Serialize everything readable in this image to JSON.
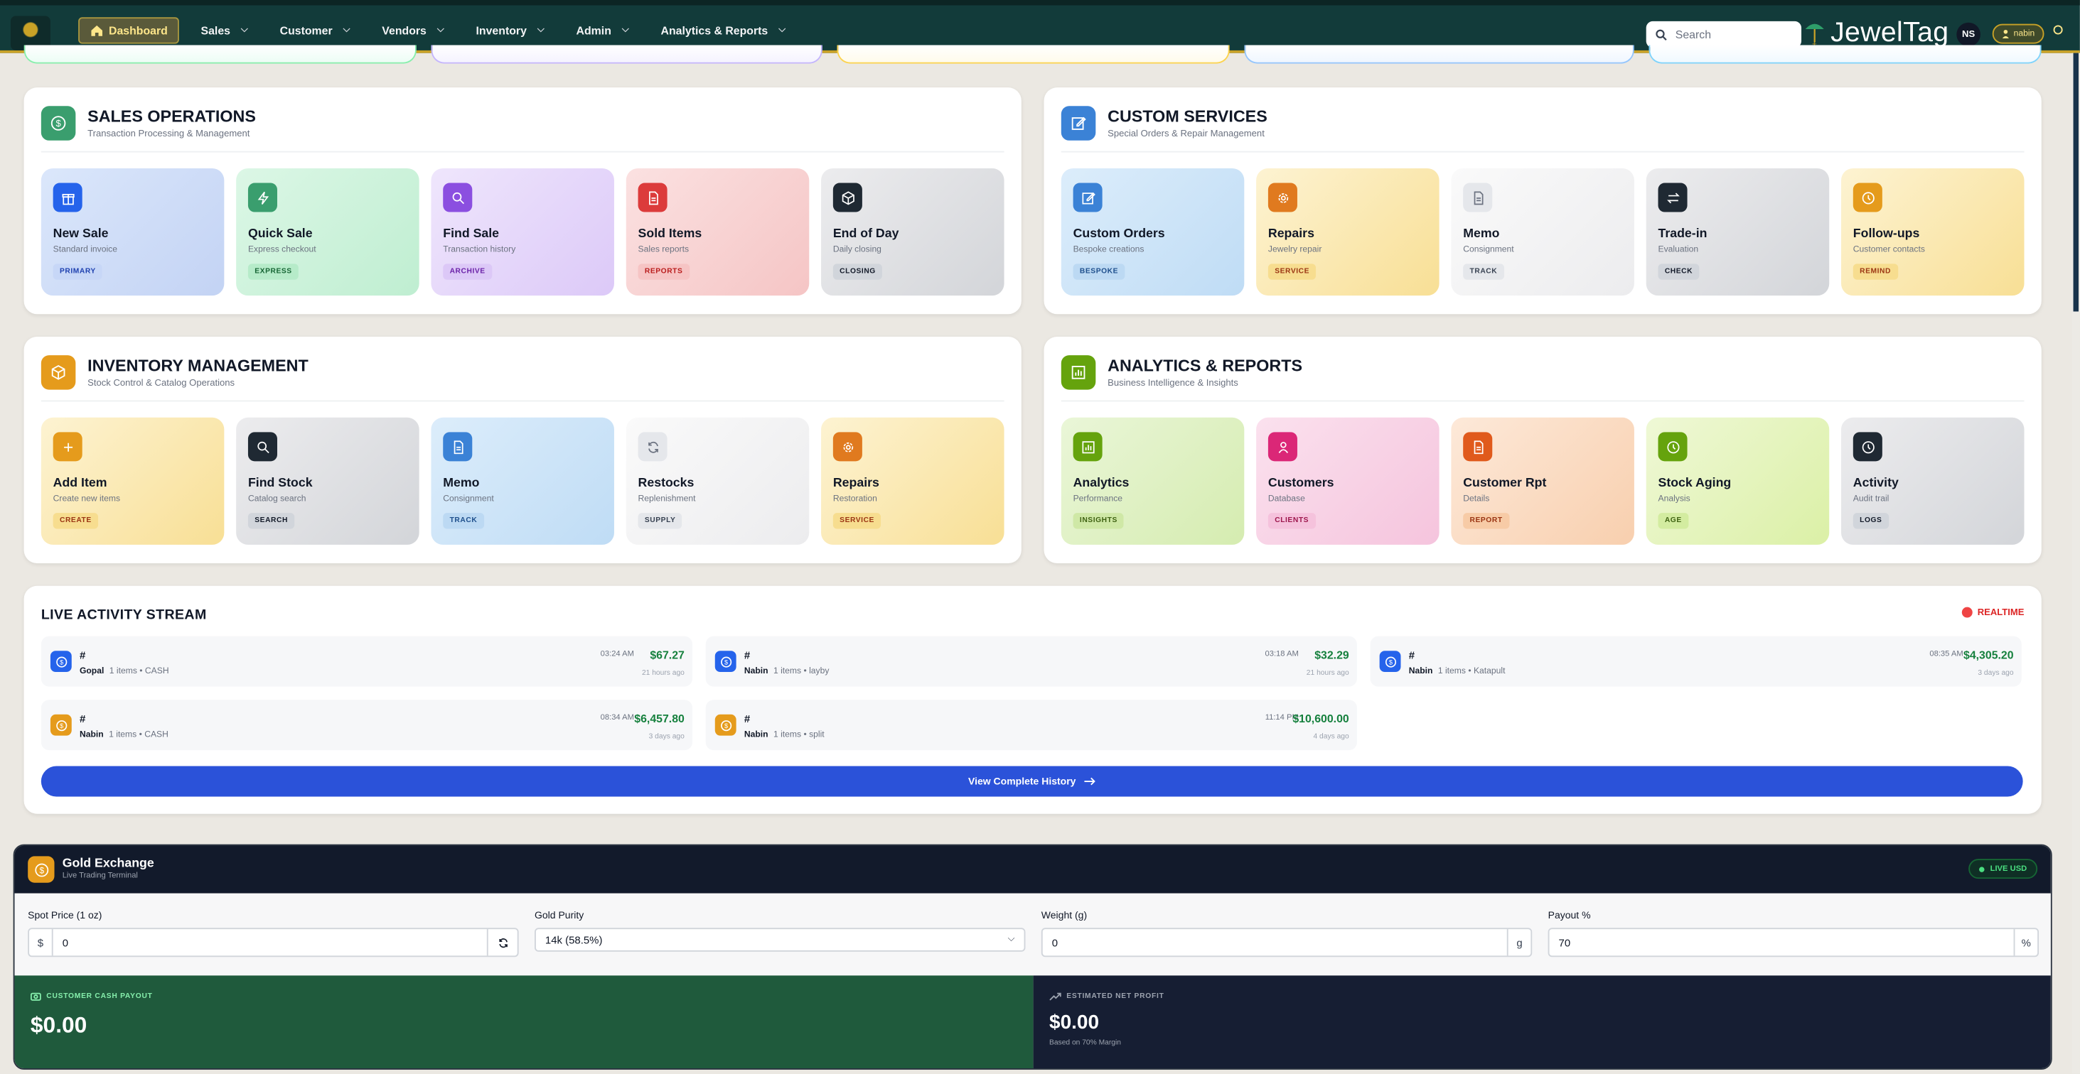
{
  "nav": {
    "items": [
      {
        "label": "Dashboard",
        "active": true
      },
      {
        "label": "Sales"
      },
      {
        "label": "Customer"
      },
      {
        "label": "Vendors"
      },
      {
        "label": "Inventory"
      },
      {
        "label": "Admin"
      },
      {
        "label": "Analytics & Reports"
      }
    ],
    "search_placeholder": "Search",
    "brand": "JewelTag",
    "avatar_initials": "NS",
    "user": "nabin"
  },
  "panels": {
    "sales": {
      "title": "SALES OPERATIONS",
      "subtitle": "Transaction Processing & Management",
      "tiles": [
        {
          "title": "New Sale",
          "subtitle": "Standard invoice",
          "tag": "PRIMARY",
          "icon": "gift-icon"
        },
        {
          "title": "Quick Sale",
          "subtitle": "Express checkout",
          "tag": "EXPRESS",
          "icon": "bolt-icon"
        },
        {
          "title": "Find Sale",
          "subtitle": "Transaction history",
          "tag": "ARCHIVE",
          "icon": "search-icon"
        },
        {
          "title": "Sold Items",
          "subtitle": "Sales reports",
          "tag": "REPORTS",
          "icon": "document-icon"
        },
        {
          "title": "End of Day",
          "subtitle": "Daily closing",
          "tag": "CLOSING",
          "icon": "box-icon"
        }
      ]
    },
    "custom": {
      "title": "CUSTOM SERVICES",
      "subtitle": "Special Orders & Repair Management",
      "tiles": [
        {
          "title": "Custom Orders",
          "subtitle": "Bespoke creations",
          "tag": "BESPOKE",
          "icon": "edit-icon"
        },
        {
          "title": "Repairs",
          "subtitle": "Jewelry repair",
          "tag": "SERVICE",
          "icon": "gear-icon"
        },
        {
          "title": "Memo",
          "subtitle": "Consignment",
          "tag": "TRACK",
          "icon": "document-icon"
        },
        {
          "title": "Trade-in",
          "subtitle": "Evaluation",
          "tag": "CHECK",
          "icon": "swap-icon"
        },
        {
          "title": "Follow-ups",
          "subtitle": "Customer contacts",
          "tag": "REMIND",
          "icon": "clock-icon"
        }
      ]
    },
    "inventory": {
      "title": "INVENTORY MANAGEMENT",
      "subtitle": "Stock Control & Catalog Operations",
      "tiles": [
        {
          "title": "Add Item",
          "subtitle": "Create new items",
          "tag": "CREATE",
          "icon": "plus-icon"
        },
        {
          "title": "Find Stock",
          "subtitle": "Catalog search",
          "tag": "SEARCH",
          "icon": "search-icon"
        },
        {
          "title": "Memo",
          "subtitle": "Consignment",
          "tag": "TRACK",
          "icon": "document-icon"
        },
        {
          "title": "Restocks",
          "subtitle": "Replenishment",
          "tag": "SUPPLY",
          "icon": "refresh-icon"
        },
        {
          "title": "Repairs",
          "subtitle": "Restoration",
          "tag": "SERVICE",
          "icon": "gear-icon"
        }
      ]
    },
    "analytics": {
      "title": "ANALYTICS & REPORTS",
      "subtitle": "Business Intelligence & Insights",
      "tiles": [
        {
          "title": "Analytics",
          "subtitle": "Performance",
          "tag": "INSIGHTS",
          "icon": "bar-chart-icon"
        },
        {
          "title": "Customers",
          "subtitle": "Database",
          "tag": "CLIENTS",
          "icon": "users-icon"
        },
        {
          "title": "Customer Rpt",
          "subtitle": "Details",
          "tag": "REPORT",
          "icon": "document-icon"
        },
        {
          "title": "Stock Aging",
          "subtitle": "Analysis",
          "tag": "AGE",
          "icon": "clock-icon"
        },
        {
          "title": "Activity",
          "subtitle": "Audit trail",
          "tag": "LOGS",
          "icon": "clock-icon"
        }
      ]
    }
  },
  "activity": {
    "title": "LIVE ACTIVITY STREAM",
    "badge": "REALTIME",
    "items": [
      {
        "hash": "#",
        "name": "Gopal",
        "meta": "1 items • CASH",
        "time": "03:24 AM",
        "amount": "$67.27",
        "ago": "21 hours ago"
      },
      {
        "hash": "#",
        "name": "Nabin",
        "meta": "1 items • layby",
        "time": "03:18 AM",
        "amount": "$32.29",
        "ago": "21 hours ago"
      },
      {
        "hash": "#",
        "name": "Nabin",
        "meta": "1 items • Katapult",
        "time": "08:35 AM",
        "amount": "$4,305.20",
        "ago": "3 days ago"
      },
      {
        "hash": "#",
        "name": "Nabin",
        "meta": "1 items • CASH",
        "time": "08:34 AM",
        "amount": "$6,457.80",
        "ago": "3 days ago"
      },
      {
        "hash": "#",
        "name": "Nabin",
        "meta": "1 items • split",
        "time": "11:14 PM",
        "amount": "$10,600.00",
        "ago": "4 days ago"
      }
    ],
    "view_all": "View Complete History"
  },
  "gold": {
    "title": "Gold Exchange",
    "subtitle": "Live Trading Terminal",
    "badge": "LIVE USD",
    "spot_label": "Spot Price (1 oz)",
    "spot_prefix": "$",
    "spot_value": "0",
    "purity_label": "Gold Purity",
    "purity_value": "14k (58.5%)",
    "weight_label": "Weight (g)",
    "weight_value": "0",
    "weight_suffix": "g",
    "payout_label": "Payout %",
    "payout_value": "70",
    "payout_suffix": "%",
    "cash_label": "CUSTOMER CASH PAYOUT",
    "cash_value": "$0.00",
    "profit_label": "ESTIMATED NET PROFIT",
    "profit_value": "$0.00",
    "profit_note": "Based on 70% Margin"
  }
}
